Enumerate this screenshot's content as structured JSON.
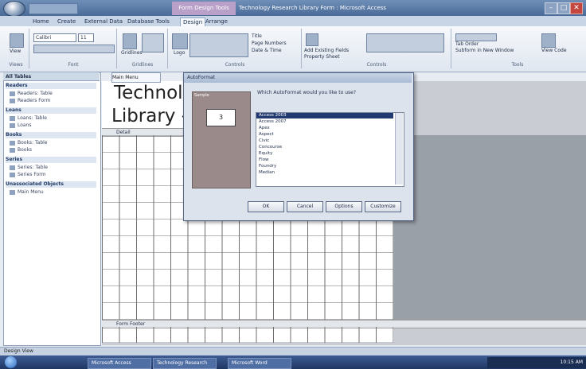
{
  "window": {
    "title": "Technology Research Library Form : Microsoft Access",
    "contextual_tab": "Form Design Tools",
    "minimize": "–",
    "maximize": "□",
    "close": "✕"
  },
  "ribbon": {
    "tabs": [
      "Home",
      "Create",
      "External Data",
      "Database Tools",
      "Design",
      "Arrange"
    ],
    "active_tab": "Design",
    "groups": [
      {
        "label": "Views",
        "items": [
          "View"
        ]
      },
      {
        "label": "Font",
        "items": [
          "Calibri",
          "11"
        ]
      },
      {
        "label": "Gridlines",
        "items": [
          "Gridlines"
        ]
      },
      {
        "label": "Controls",
        "items": [
          "Logo",
          "Title",
          "Page Numbers",
          "Date & Time"
        ]
      },
      {
        "label": "Controls",
        "items": [
          "Add Existing Fields",
          "Property Sheet"
        ]
      },
      {
        "label": "Tools",
        "items": [
          "Tab Order",
          "Subform in New Window",
          "View Code"
        ]
      }
    ]
  },
  "nav": {
    "header": "All Tables",
    "groups": [
      {
        "name": "Readers",
        "items": [
          "Readers: Table",
          "Readers Form"
        ]
      },
      {
        "name": "Loans",
        "items": [
          "Loans: Table",
          "Loans"
        ]
      },
      {
        "name": "Books",
        "items": [
          "Books: Table",
          "Books"
        ]
      },
      {
        "name": "Series",
        "items": [
          "Series: Table",
          "Series Form"
        ]
      },
      {
        "name": "Unassociated Objects",
        "items": [
          "Main Menu"
        ]
      }
    ]
  },
  "document": {
    "tab": "Main Menu",
    "heading_line1": "Technolo",
    "heading_line2": "Library -",
    "detail_section": "Detail",
    "footer_section": "Form Footer"
  },
  "dialog": {
    "title": "AutoFormat",
    "sample_label": "Sample",
    "sample_value": "3",
    "prompt": "Which AutoFormat would you like to use?",
    "options": [
      "Access 2003",
      "Access 2007",
      "Apex",
      "Aspect",
      "Civic",
      "Concourse",
      "Equity",
      "Flow",
      "Foundry",
      "Median"
    ],
    "selected": "Access 2003",
    "buttons": [
      "OK",
      "Cancel",
      "Options",
      "Customize"
    ]
  },
  "status": {
    "text": "Design View"
  },
  "taskbar": {
    "tasks": [
      "Microsoft Access",
      "Technology Research",
      "Microsoft Word"
    ],
    "clock": "10:15 AM"
  },
  "colors": {
    "title_bar": "#4a6b98",
    "selection": "#223a70",
    "contextual_tab": "#b9a0c9"
  }
}
